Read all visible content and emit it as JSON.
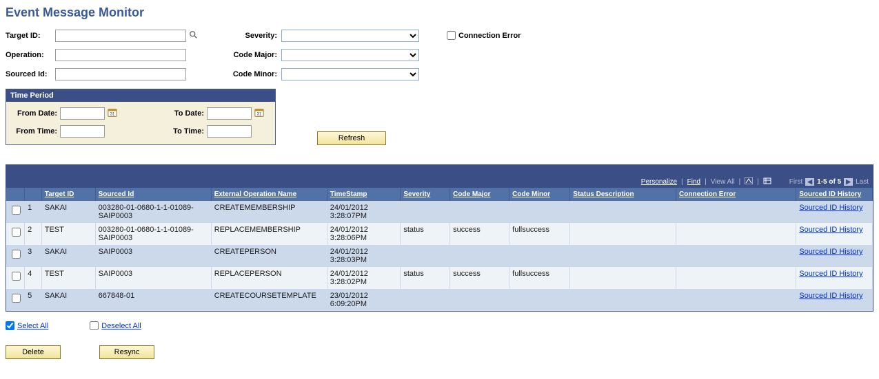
{
  "title": "Event Message Monitor",
  "filters": {
    "target_label": "Target ID:",
    "target_value": "",
    "operation_label": "Operation:",
    "operation_value": "",
    "sourced_label": "Sourced Id:",
    "sourced_value": "",
    "severity_label": "Severity:",
    "code_major_label": "Code Major:",
    "code_minor_label": "Code Minor:",
    "conn_err_label": "Connection Error"
  },
  "time_period": {
    "header": "Time Period",
    "from_date_label": "From Date:",
    "to_date_label": "To Date:",
    "from_time_label": "From Time:",
    "to_time_label": "To Time:"
  },
  "buttons": {
    "refresh": "Refresh",
    "delete": "Delete",
    "resync": "Resync",
    "select_all": "Select All",
    "deselect_all": "Deselect All"
  },
  "grid_meta": {
    "personalize": "Personalize",
    "find": "Find",
    "view_all": "View All",
    "first": "First",
    "range": "1-5 of 5",
    "last": "Last"
  },
  "columns": {
    "target": "Target ID",
    "sourced": "Sourced Id",
    "ext_op": "External Operation Name",
    "ts": "TimeStamp",
    "severity": "Severity",
    "code_major": "Code Major",
    "code_minor": "Code Minor",
    "status_desc": "Status Description",
    "conn_err": "Connection Error",
    "history": "Sourced ID History"
  },
  "rows": [
    {
      "n": "1",
      "target": "SAKAI",
      "sourced": "003280-01-0680-1-1-01089-SAIP0003",
      "op": "CREATEMEMBERSHIP",
      "ts": "24/01/2012 3:28:07PM",
      "sev": "",
      "maj": "",
      "min": "",
      "desc": "",
      "err": "",
      "hist": "Sourced ID History"
    },
    {
      "n": "2",
      "target": "TEST",
      "sourced": "003280-01-0680-1-1-01089-SAIP0003",
      "op": "REPLACEMEMBERSHIP",
      "ts": "24/01/2012 3:28:06PM",
      "sev": "status",
      "maj": "success",
      "min": "fullsuccess",
      "desc": "",
      "err": "",
      "hist": "Sourced ID History"
    },
    {
      "n": "3",
      "target": "SAKAI",
      "sourced": "SAIP0003",
      "op": "CREATEPERSON",
      "ts": "24/01/2012 3:28:03PM",
      "sev": "",
      "maj": "",
      "min": "",
      "desc": "",
      "err": "",
      "hist": "Sourced ID History"
    },
    {
      "n": "4",
      "target": "TEST",
      "sourced": "SAIP0003",
      "op": "REPLACEPERSON",
      "ts": "24/01/2012 3:28:02PM",
      "sev": "status",
      "maj": "success",
      "min": "fullsuccess",
      "desc": "",
      "err": "",
      "hist": "Sourced ID History"
    },
    {
      "n": "5",
      "target": "SAKAI",
      "sourced": "667848-01",
      "op": "CREATECOURSETEMPLATE",
      "ts": "23/01/2012 6:09:20PM",
      "sev": "",
      "maj": "",
      "min": "",
      "desc": "",
      "err": "",
      "hist": "Sourced ID History"
    }
  ]
}
